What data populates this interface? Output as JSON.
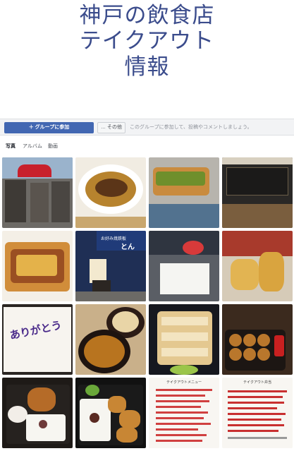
{
  "title": {
    "line1": "神戸の飲食店",
    "line2": "テイクアウト",
    "line3": "情報"
  },
  "group_bar": {
    "join_label": "＋ グループに参加",
    "more_label": "… その他",
    "note": "このグループに参加して、投稿やコメントしましょう。"
  },
  "tabs": [
    {
      "label": "写真",
      "active": true
    },
    {
      "label": "アルバム",
      "active": false
    },
    {
      "label": "動画",
      "active": false
    }
  ],
  "photos": {
    "p2_sign": "お好み焼鉄板",
    "p2_sign2": "とん",
    "p3_card": "ありがとう",
    "p4_menu_title": "テイクアウトメニュー",
    "p4_menu_title2": "テイクアウト弁当"
  },
  "colors": {
    "title": "#3b4c8c",
    "join_button": "#4267b2"
  }
}
